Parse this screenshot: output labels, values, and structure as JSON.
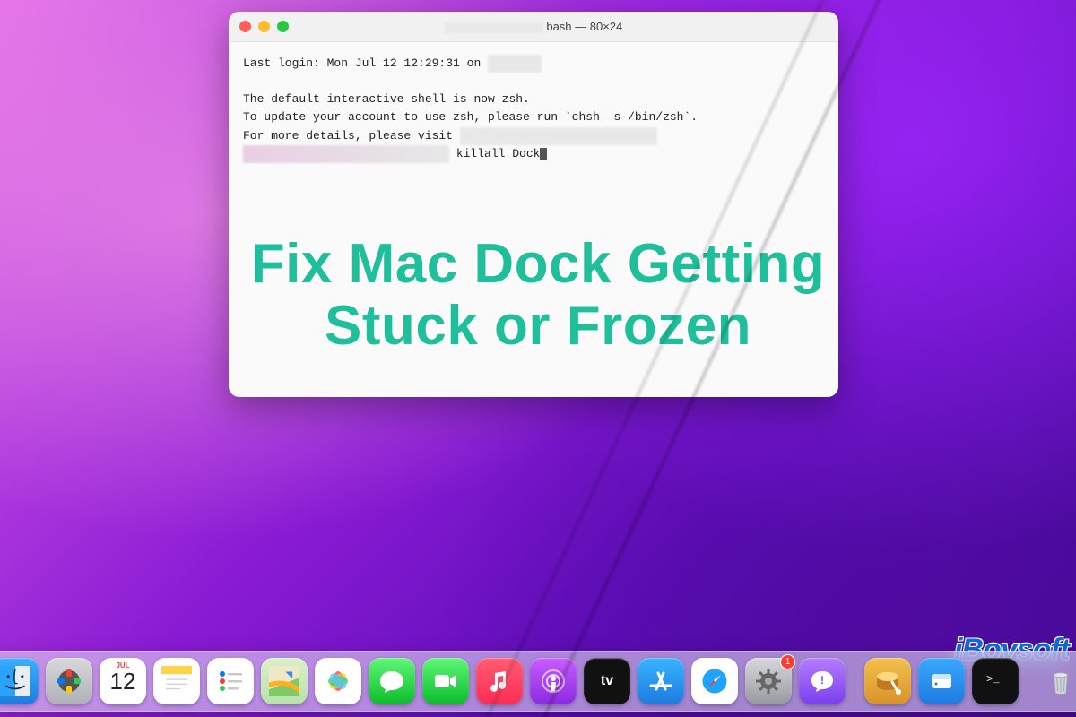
{
  "window": {
    "title": "bash — 80×24"
  },
  "terminal": {
    "line1_prefix": "Last login: Mon Jul 12 12:29:31 on ",
    "line2": "The default interactive shell is now zsh.",
    "line3": "To update your account to use zsh, please run `chsh -s /bin/zsh`.",
    "line4_prefix": "For more details, please visit",
    "command": "killall Dock"
  },
  "overlay": {
    "headline_l1": "Fix Mac Dock Getting",
    "headline_l2": "Stuck or Frozen"
  },
  "watermark": {
    "text": "iBoysoft"
  },
  "calendar": {
    "month": "JUL",
    "day": "12"
  },
  "settings_badge": "1",
  "dock_items": [
    {
      "name": "finder",
      "label": "Finder"
    },
    {
      "name": "launchpad",
      "label": "Launchpad"
    },
    {
      "name": "calendar",
      "label": "Calendar"
    },
    {
      "name": "notes",
      "label": "Notes"
    },
    {
      "name": "reminders",
      "label": "Reminders"
    },
    {
      "name": "maps",
      "label": "Maps"
    },
    {
      "name": "photos",
      "label": "Photos"
    },
    {
      "name": "messages",
      "label": "Messages"
    },
    {
      "name": "facetime",
      "label": "FaceTime"
    },
    {
      "name": "music",
      "label": "Music"
    },
    {
      "name": "podcasts",
      "label": "Podcasts"
    },
    {
      "name": "tv",
      "label": "TV"
    },
    {
      "name": "appstore",
      "label": "App Store"
    },
    {
      "name": "safari",
      "label": "Safari"
    },
    {
      "name": "system-preferences",
      "label": "System Preferences"
    },
    {
      "name": "feedback",
      "label": "Feedback Assistant"
    },
    {
      "name": "disk",
      "label": "Disk Utility"
    },
    {
      "name": "iboysoft",
      "label": "iBoysoft"
    },
    {
      "name": "terminal",
      "label": "Terminal"
    },
    {
      "name": "trash",
      "label": "Trash"
    }
  ]
}
